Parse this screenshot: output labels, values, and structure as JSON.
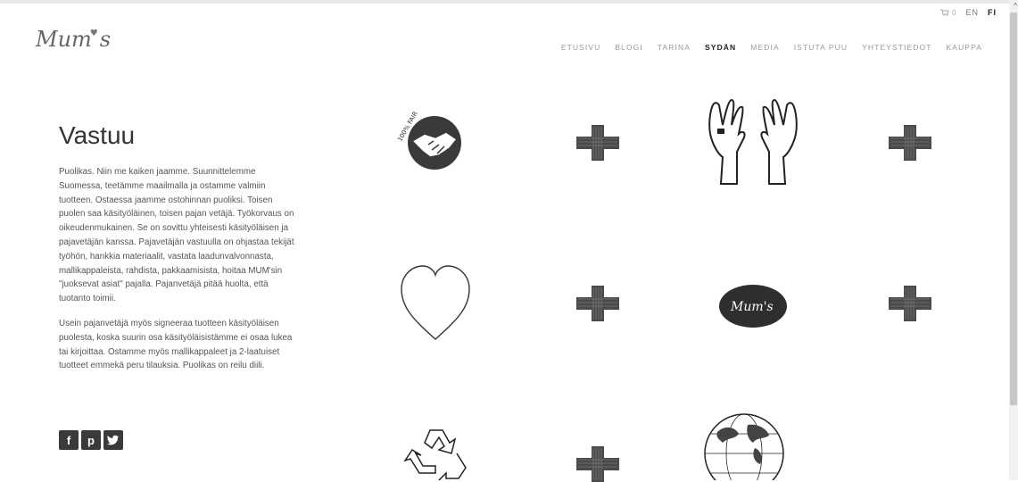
{
  "topbar": {
    "cart_count": "0",
    "languages": [
      "EN",
      "FI"
    ],
    "active_language": "FI"
  },
  "logo": {
    "text": "Mum",
    "suffix": "s"
  },
  "nav": {
    "items": [
      "ETUSIVU",
      "BLOGI",
      "TARINA",
      "SYDÄN",
      "MEDIA",
      "ISTUTA PUU",
      "YHTEYSTIEDOT",
      "KAUPPA"
    ],
    "active": "SYDÄN"
  },
  "content": {
    "title": "Vastuu",
    "paragraphs": [
      "Puolikas. Niin me kaiken jaamme. Suunnittelemme Suomessa, teetämme maailmalla ja ostamme valmiin tuotteen. Ostaessa jaamme ostohinnan puoliksi. Toisen puolen saa käsityöläinen, toisen pajan vetäjä. Työkorvaus on oikeudenmukainen. Se on sovittu yhteisesti käsityöläisen ja pajavetäjän kanssa. Pajavetäjän vastuulla on ohjastaa tekijät työhön, hankkia materiaalit, vastata laadunvalvonnasta, mallikappaleista, rahdista, pakkaamisista, hoitaa MUM'sin \"juoksevat asiat\" pajalla. Pajanvetäjä pitää huolta, että tuotanto toimii.",
      "Usein pajanvetäjä myös signeeraa tuotteen käsityöläisen puolesta, koska suurin osa käsityöläisistämme ei osaa lukea tai kirjoittaa. Ostamme myös mallikappaleet ja 2-laatuiset tuotteet emmekä peru tilauksia. Puolikas on reilu diili."
    ]
  },
  "social": {
    "icons": [
      "f",
      "p",
      "t"
    ]
  },
  "graphics": {
    "fair_badge_text": "100% FAIR",
    "badge_logo_text": "Mum's"
  }
}
